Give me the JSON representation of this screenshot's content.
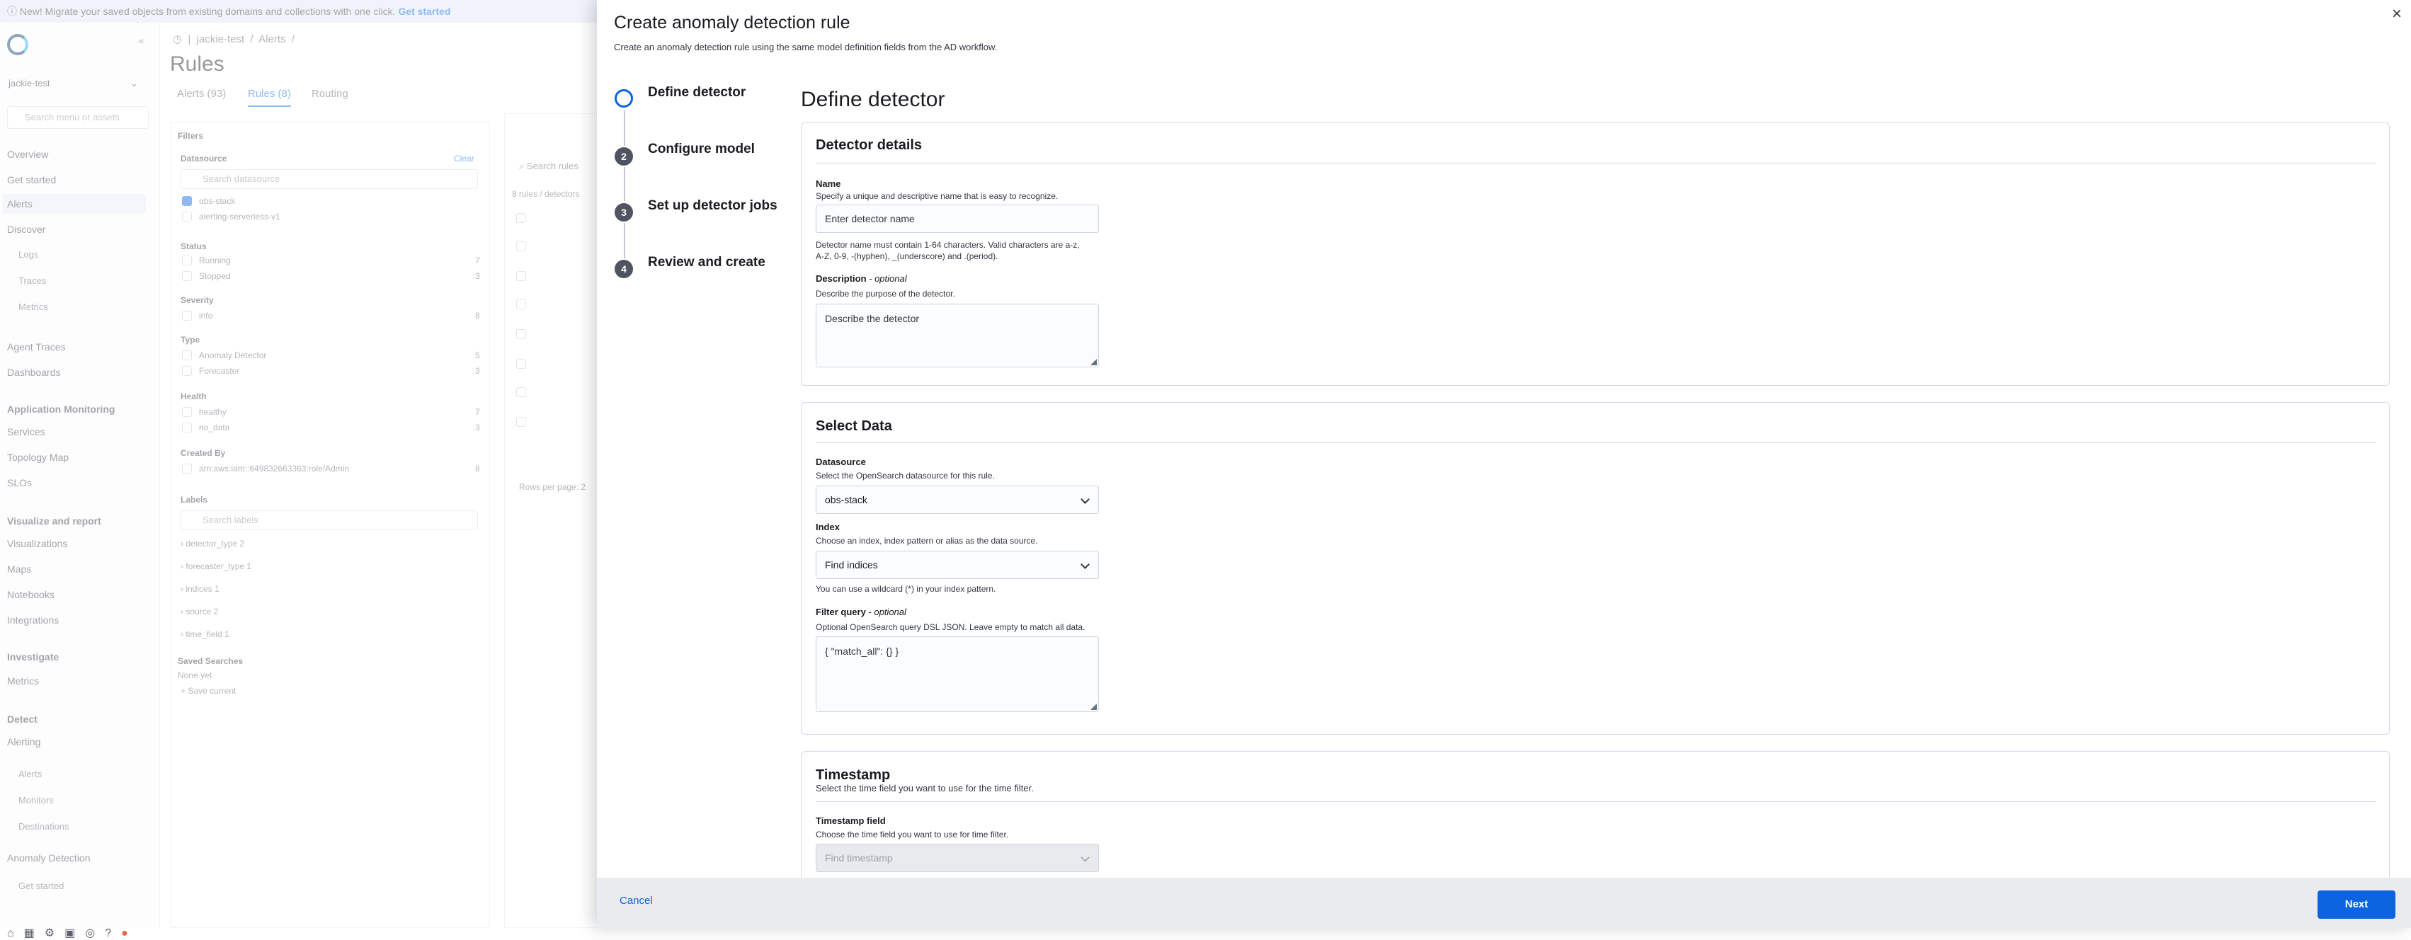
{
  "banner": {
    "text": "New! Migrate your saved objects from existing domains and collections with one click.",
    "link": "Get started"
  },
  "sidenav": {
    "workspace": "jackie-test",
    "search_placeholder": "Search menu or assets",
    "items": [
      "Overview",
      "Get started",
      "Alerts",
      "Discover"
    ],
    "discover_sub": [
      "Logs",
      "Traces",
      "Metrics"
    ],
    "items2": [
      "Agent Traces",
      "Dashboards"
    ],
    "sec_app_monitoring": "Application Monitoring",
    "app_items": [
      "Services",
      "Topology Map",
      "SLOs"
    ],
    "sec_visualize": "Visualize and report",
    "vis_items": [
      "Visualizations",
      "Maps",
      "Notebooks",
      "Integrations"
    ],
    "sec_investigate": "Investigate",
    "inv_items": [
      "Metrics"
    ],
    "sec_detect": "Detect",
    "detect_items": [
      "Alerting"
    ],
    "alerting_sub": [
      "Alerts",
      "Monitors",
      "Destinations"
    ],
    "ad_item": "Anomaly Detection",
    "ad_sub": [
      "Get started"
    ]
  },
  "background_page": {
    "breadcrumb": [
      "jackie-test",
      "Alerts"
    ],
    "title": "Rules",
    "tabs": [
      "Alerts (93)",
      "Rules (8)",
      "Routing"
    ],
    "filters": {
      "title": "Filters",
      "datasource_label": "Datasource",
      "clear": "Clear",
      "datasource_search": "Search datasource",
      "datasources": [
        "obs-stack",
        "alerting-serverless-v1"
      ],
      "status_label": "Status",
      "statuses": [
        {
          "name": "Running",
          "count": "7"
        },
        {
          "name": "Stopped",
          "count": "3"
        }
      ],
      "severity_label": "Severity",
      "severities": [
        {
          "name": "info",
          "count": "8"
        }
      ],
      "type_label": "Type",
      "types": [
        {
          "name": "Anomaly Detector",
          "count": "5"
        },
        {
          "name": "Forecaster",
          "count": "3"
        }
      ],
      "health_label": "Health",
      "healths": [
        {
          "name": "healthy",
          "count": "7"
        },
        {
          "name": "no_data",
          "count": "3"
        }
      ],
      "created_by_label": "Created By",
      "created_by": [
        {
          "name": "arn:aws:iam::649832663363:role/Admin",
          "count": "8"
        }
      ],
      "labels_label": "Labels",
      "labels_search": "Search labels",
      "labels": [
        {
          "name": "detector_type",
          "count": "2"
        },
        {
          "name": "forecaster_type",
          "count": "1"
        },
        {
          "name": "indices",
          "count": "1"
        },
        {
          "name": "source",
          "count": "2"
        },
        {
          "name": "time_field",
          "count": "1"
        }
      ],
      "saved_searches_label": "Saved Searches",
      "saved_none": "None yet",
      "save_current": "Save current"
    },
    "rules_search": "Search rules",
    "rules_count": "8 rules / detectors",
    "rows_per_page": "Rows per page: 2"
  },
  "flyout": {
    "title": "Create anomaly detection rule",
    "subtitle": "Create an anomaly detection rule using the same model definition fields from the AD workflow.",
    "steps": [
      {
        "num": "",
        "label": "Define detector"
      },
      {
        "num": "2",
        "label": "Configure model"
      },
      {
        "num": "3",
        "label": "Set up detector jobs"
      },
      {
        "num": "4",
        "label": "Review and create"
      }
    ],
    "main_title": "Define detector",
    "detector_details": {
      "title": "Detector details",
      "name_label": "Name",
      "name_help": "Specify a unique and descriptive name that is easy to recognize.",
      "name_placeholder": "Enter detector name",
      "name_rules_1": "Detector name must contain 1-64 characters. Valid characters are a-z,",
      "name_rules_2": "A-Z, 0-9, -(hyphen), _(underscore) and .(period).",
      "desc_label": "Description",
      "desc_optional": "- optional",
      "desc_help": "Describe the purpose of the detector.",
      "desc_placeholder": "Describe the detector"
    },
    "select_data": {
      "title": "Select Data",
      "datasource_label": "Datasource",
      "datasource_help": "Select the OpenSearch datasource for this rule.",
      "datasource_value": "obs-stack",
      "index_label": "Index",
      "index_help": "Choose an index, index pattern or alias as the data source.",
      "index_placeholder": "Find indices",
      "index_note": "You can use a wildcard (*) in your index pattern.",
      "filter_label": "Filter query",
      "filter_optional": "- optional",
      "filter_help": "Optional OpenSearch query DSL JSON. Leave empty to match all data.",
      "filter_value": "{ \"match_all\": {} }"
    },
    "timestamp": {
      "title": "Timestamp",
      "help": "Select the time field you want to use for the time filter.",
      "field_label": "Timestamp field",
      "field_help": "Choose the time field you want to use for time filter.",
      "field_placeholder": "Find timestamp"
    },
    "footer": {
      "cancel": "Cancel",
      "next": "Next"
    }
  },
  "colors": {
    "primary": "#0b64dd",
    "step_inactive": "#4f5461",
    "footer_bg": "#e9ebef"
  }
}
